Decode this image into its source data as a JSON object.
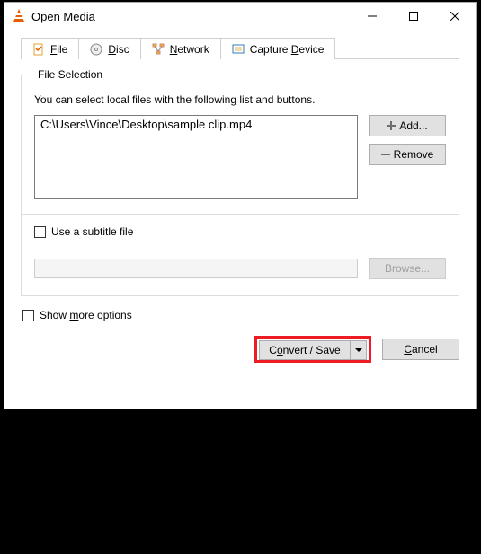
{
  "window": {
    "title": "Open Media"
  },
  "tabs": {
    "file": {
      "label_pre": "",
      "hot": "F",
      "label_post": "ile"
    },
    "disc": {
      "label_pre": "",
      "hot": "D",
      "label_post": "isc"
    },
    "network": {
      "label_pre": "",
      "hot": "N",
      "label_post": "etwork"
    },
    "capture": {
      "label_pre": "Capture ",
      "hot": "D",
      "label_post": "evice"
    }
  },
  "file_selection": {
    "legend": "File Selection",
    "hint": "You can select local files with the following list and buttons.",
    "files": [
      "C:\\Users\\Vince\\Desktop\\sample clip.mp4"
    ],
    "add_label": "Add...",
    "remove_label": "Remove"
  },
  "subtitle": {
    "checkbox_label": "Use a subtitle file",
    "browse_label": "Browse..."
  },
  "more_options": {
    "label_pre": "Show ",
    "hot": "m",
    "label_post": "ore options"
  },
  "actions": {
    "convert_pre": "C",
    "convert_hot": "o",
    "convert_post": "nvert / Save",
    "cancel_pre": "",
    "cancel_hot": "C",
    "cancel_post": "ancel"
  }
}
